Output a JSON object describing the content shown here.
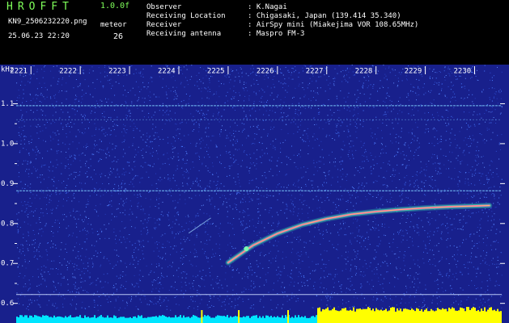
{
  "header": {
    "title": "HROFFT",
    "version": "1.0.0f",
    "filename": "KN9_2506232220.png",
    "meteor_label": "meteor",
    "datetime": "25.06.23 22:20",
    "meteor_count": "26",
    "info": [
      {
        "key": "Observer",
        "value": ": K.Nagai"
      },
      {
        "key": "Receiving Location",
        "value": ": Chigasaki, Japan (139.414 35.340)"
      },
      {
        "key": "Receiver",
        "value": ": AirSpy mini (Miakejima VOR 108.65MHz)"
      },
      {
        "key": "Receiving antenna",
        "value": ": Maspro FM-3"
      }
    ]
  },
  "chart_data": {
    "type": "heatmap",
    "unit_label": "kHz",
    "x_ticks": [
      "2221",
      "2222",
      "2223",
      "2224",
      "2225",
      "2226",
      "2227",
      "2228",
      "2229",
      "2230"
    ],
    "y_ticks": [
      "1.1",
      "1.0",
      "0.9",
      "0.8",
      "0.7",
      "0.6"
    ],
    "ylim": [
      0.58,
      1.18
    ],
    "background_color": "#18208c",
    "noise_color": "#4a7cff",
    "carrier_lines_khz": [
      1.095,
      1.06,
      0.882,
      0.622
    ],
    "meteor_echo": {
      "points": [
        {
          "x": 2225.0,
          "y": 0.702
        },
        {
          "x": 2225.5,
          "y": 0.745
        },
        {
          "x": 2226.0,
          "y": 0.775
        },
        {
          "x": 2226.5,
          "y": 0.797
        },
        {
          "x": 2227.0,
          "y": 0.812
        },
        {
          "x": 2227.5,
          "y": 0.823
        },
        {
          "x": 2228.0,
          "y": 0.83
        },
        {
          "x": 2228.5,
          "y": 0.835
        },
        {
          "x": 2229.0,
          "y": 0.839
        },
        {
          "x": 2229.5,
          "y": 0.842
        },
        {
          "x": 2230.3,
          "y": 0.845
        }
      ]
    },
    "faint_streak": [
      {
        "x": 2224.2,
        "y": 0.776
      },
      {
        "x": 2224.65,
        "y": 0.814
      }
    ]
  }
}
